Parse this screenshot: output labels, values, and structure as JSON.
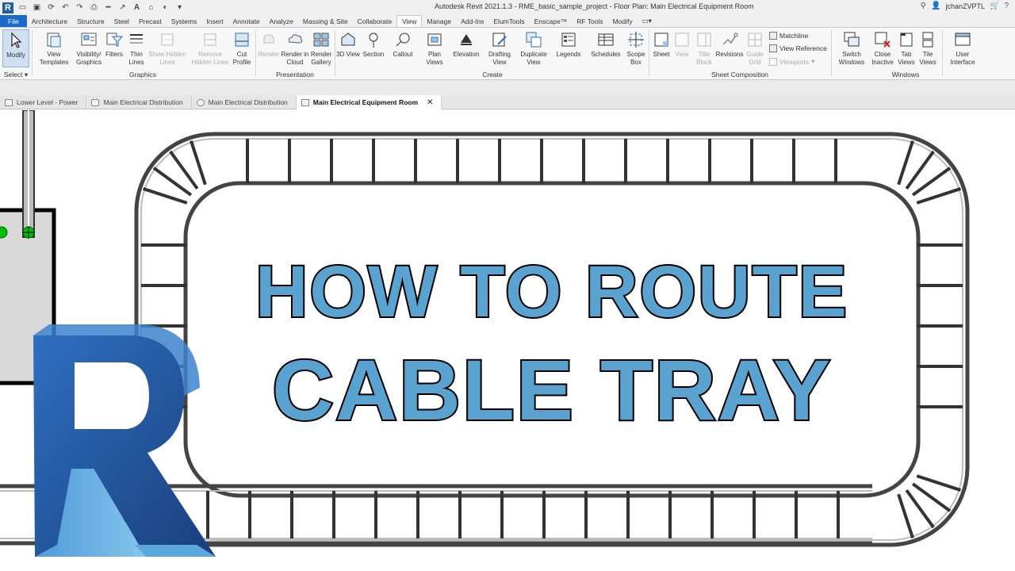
{
  "window": {
    "title": "Autodesk Revit 2021.1.3 - RME_basic_sample_project - Floor Plan: Main Electrical Equipment Room",
    "app_letter": "R",
    "username": "jchanZVPTL",
    "help": "?"
  },
  "menu": {
    "tabs": [
      "File",
      "Architecture",
      "Structure",
      "Steel",
      "Precast",
      "Systems",
      "Insert",
      "Annotate",
      "Analyze",
      "Massing & Site",
      "Collaborate",
      "View",
      "Manage",
      "Add-Ins",
      "ElumTools",
      "Enscape™",
      "RF Tools",
      "Modify"
    ],
    "active": "View"
  },
  "ribbon": {
    "select": {
      "modify": "Modify",
      "label": "Select"
    },
    "graphics": {
      "label": "Graphics",
      "view_templates": "View Templates",
      "visibility_graphics": "Visibility/ Graphics",
      "filters": "Filters",
      "thin_lines": "Thin Lines",
      "show_hidden_lines": "Show Hidden Lines",
      "remove_hidden_lines": "Remove Hidden Lines",
      "cut_profile": "Cut Profile"
    },
    "presentation": {
      "label": "Presentation",
      "render": "Render",
      "render_in_cloud": "Render in Cloud",
      "render_gallery": "Render Gallery"
    },
    "create": {
      "label": "Create",
      "view_3d": "3D View",
      "section": "Section",
      "callout": "Callout",
      "plan_views": "Plan Views",
      "elevation": "Elevation",
      "drafting_view": "Drafting View",
      "duplicate_view": "Duplicate View",
      "legends": "Legends",
      "schedules": "Schedules",
      "scope_box": "Scope Box"
    },
    "sheet_composition": {
      "label": "Sheet Composition",
      "sheet": "Sheet",
      "view": "View",
      "title_block": "Title Block",
      "revisions": "Revisions",
      "guide_grid": "Guide Grid",
      "matchline": "Matchline",
      "view_reference": "View Reference",
      "viewports": "Viewports"
    },
    "windows": {
      "label": "Windows",
      "switch_windows": "Switch Windows",
      "close_inactive": "Close Inactive",
      "tab_views": "Tab Views",
      "tile_views": "Tile Views"
    },
    "user_interface": "User Interface"
  },
  "view_tabs": [
    {
      "label": "Lower Level - Power",
      "active": false
    },
    {
      "label": "Main Electrical Distribution",
      "active": false
    },
    {
      "label": "Main Electrical Distribution",
      "active": false
    },
    {
      "label": "Main Electrical Equipment Room",
      "active": true
    }
  ],
  "headline": {
    "line1": "HOW TO ROUTE",
    "line2": "CABLE TRAY"
  },
  "colors": {
    "accent_blue": "#1b6ac9",
    "headline_fill": "#5aa2d0",
    "logo_dark": "#1f4f96",
    "logo_light": "#67b3e0",
    "connector_green": "#00c000"
  }
}
